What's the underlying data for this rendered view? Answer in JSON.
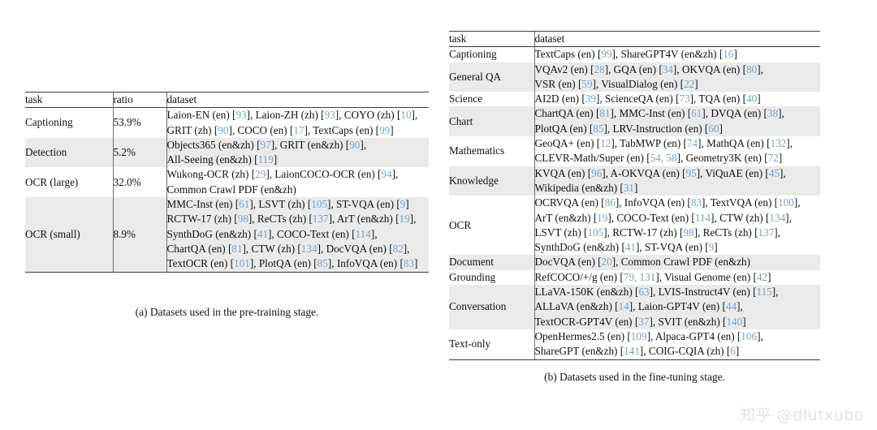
{
  "page": {
    "background": "#ffffff",
    "citation_color": "#7ba2c4",
    "stripe_color": "#eaeaea",
    "rule_color": "#3b3b3b"
  },
  "watermark": {
    "text": "知乎 @dlutxubo"
  },
  "table_a": {
    "caption": "(a) Datasets used in the pre-training stage.",
    "headers": [
      "task",
      "ratio",
      "dataset"
    ],
    "rows": [
      {
        "task": "Captioning",
        "ratio": "53.9%",
        "stripe": false,
        "lines": [
          [
            {
              "t": "Laion-EN (en) ["
            },
            {
              "t": "93",
              "c": true
            },
            {
              "t": "], Laion-ZH (zh) ["
            },
            {
              "t": "93",
              "c": true
            },
            {
              "t": "], COYO (zh) ["
            },
            {
              "t": "10",
              "c": true
            },
            {
              "t": "],"
            }
          ],
          [
            {
              "t": "GRIT (zh) ["
            },
            {
              "t": "90",
              "c": true
            },
            {
              "t": "], COCO (en) ["
            },
            {
              "t": "17",
              "c": true
            },
            {
              "t": "], TextCaps (en) ["
            },
            {
              "t": "99",
              "c": true
            },
            {
              "t": "]"
            }
          ]
        ]
      },
      {
        "task": "Detection",
        "ratio": "5.2%",
        "stripe": true,
        "lines": [
          [
            {
              "t": "Objects365 (en&zh) ["
            },
            {
              "t": "97",
              "c": true
            },
            {
              "t": "], GRIT (en&zh) ["
            },
            {
              "t": "90",
              "c": true
            },
            {
              "t": "],"
            }
          ],
          [
            {
              "t": "All-Seeing (en&zh) ["
            },
            {
              "t": "119",
              "c": true
            },
            {
              "t": "]"
            }
          ]
        ]
      },
      {
        "task": "OCR (large)",
        "ratio": "32.0%",
        "stripe": false,
        "lines": [
          [
            {
              "t": "Wukong-OCR (zh) ["
            },
            {
              "t": "29",
              "c": true
            },
            {
              "t": "], LaionCOCO-OCR (en) ["
            },
            {
              "t": "94",
              "c": true
            },
            {
              "t": "],"
            }
          ],
          [
            {
              "t": "Common Crawl PDF (en&zh)"
            }
          ]
        ]
      },
      {
        "task": "OCR (small)",
        "ratio": "8.9%",
        "stripe": true,
        "lines": [
          [
            {
              "t": "MMC-Inst (en) ["
            },
            {
              "t": "61",
              "c": true
            },
            {
              "t": "], LSVT (zh) ["
            },
            {
              "t": "105",
              "c": true
            },
            {
              "t": "], ST-VQA (en) ["
            },
            {
              "t": "9",
              "c": true
            },
            {
              "t": "]"
            }
          ],
          [
            {
              "t": "RCTW-17 (zh) ["
            },
            {
              "t": "98",
              "c": true
            },
            {
              "t": "], ReCTs (zh) ["
            },
            {
              "t": "137",
              "c": true
            },
            {
              "t": "], ArT (en&zh) ["
            },
            {
              "t": "19",
              "c": true
            },
            {
              "t": "],"
            }
          ],
          [
            {
              "t": "SynthDoG (en&zh) ["
            },
            {
              "t": "41",
              "c": true
            },
            {
              "t": "], COCO-Text (en) ["
            },
            {
              "t": "114",
              "c": true
            },
            {
              "t": "],"
            }
          ],
          [
            {
              "t": "ChartQA (en) ["
            },
            {
              "t": "81",
              "c": true
            },
            {
              "t": "], CTW (zh) ["
            },
            {
              "t": "134",
              "c": true
            },
            {
              "t": "], DocVQA (en) ["
            },
            {
              "t": "82",
              "c": true
            },
            {
              "t": "],"
            }
          ],
          [
            {
              "t": "TextOCR (en) ["
            },
            {
              "t": "101",
              "c": true
            },
            {
              "t": "], PlotQA (en) ["
            },
            {
              "t": "85",
              "c": true
            },
            {
              "t": "], InfoVQA (en) ["
            },
            {
              "t": "83",
              "c": true
            },
            {
              "t": "]"
            }
          ]
        ]
      }
    ]
  },
  "table_b": {
    "caption": "(b) Datasets used in the fine-tuning stage.",
    "headers": [
      "task",
      "dataset"
    ],
    "rows": [
      {
        "task": "Captioning",
        "stripe": false,
        "lines": [
          [
            {
              "t": "TextCaps (en) ["
            },
            {
              "t": "99",
              "c": true
            },
            {
              "t": "], ShareGPT4V (en&zh) ["
            },
            {
              "t": "16",
              "c": true
            },
            {
              "t": "]"
            }
          ]
        ]
      },
      {
        "task": "General QA",
        "stripe": true,
        "lines": [
          [
            {
              "t": "VQAv2 (en) ["
            },
            {
              "t": "28",
              "c": true
            },
            {
              "t": "], GQA (en) ["
            },
            {
              "t": "34",
              "c": true
            },
            {
              "t": "], OKVQA (en) ["
            },
            {
              "t": "80",
              "c": true
            },
            {
              "t": "],"
            }
          ],
          [
            {
              "t": "VSR (en) ["
            },
            {
              "t": "59",
              "c": true
            },
            {
              "t": "], VisualDialog (en) ["
            },
            {
              "t": "22",
              "c": true
            },
            {
              "t": "]"
            }
          ]
        ]
      },
      {
        "task": "Science",
        "stripe": false,
        "lines": [
          [
            {
              "t": "AI2D (en) ["
            },
            {
              "t": "39",
              "c": true
            },
            {
              "t": "], ScienceQA (en) ["
            },
            {
              "t": "73",
              "c": true
            },
            {
              "t": "], TQA (en) ["
            },
            {
              "t": "40",
              "c": true
            },
            {
              "t": "]"
            }
          ]
        ]
      },
      {
        "task": "Chart",
        "stripe": true,
        "lines": [
          [
            {
              "t": "ChartQA (en) ["
            },
            {
              "t": "81",
              "c": true
            },
            {
              "t": "], MMC-Inst (en) ["
            },
            {
              "t": "61",
              "c": true
            },
            {
              "t": "], DVQA (en) ["
            },
            {
              "t": "38",
              "c": true
            },
            {
              "t": "],"
            }
          ],
          [
            {
              "t": "PlotQA (en) ["
            },
            {
              "t": "85",
              "c": true
            },
            {
              "t": "], LRV-Instruction (en) ["
            },
            {
              "t": "60",
              "c": true
            },
            {
              "t": "]"
            }
          ]
        ]
      },
      {
        "task": "Mathematics",
        "stripe": false,
        "lines": [
          [
            {
              "t": "GeoQA+ (en) ["
            },
            {
              "t": "12",
              "c": true
            },
            {
              "t": "], TabMWP (en) ["
            },
            {
              "t": "74",
              "c": true
            },
            {
              "t": "], MathQA (en) ["
            },
            {
              "t": "132",
              "c": true
            },
            {
              "t": "],"
            }
          ],
          [
            {
              "t": "CLEVR-Math/Super (en) ["
            },
            {
              "t": "54, 58",
              "c": true
            },
            {
              "t": "], Geometry3K (en) ["
            },
            {
              "t": "72",
              "c": true
            },
            {
              "t": "]"
            }
          ]
        ]
      },
      {
        "task": "Knowledge",
        "stripe": true,
        "lines": [
          [
            {
              "t": "KVQA (en) ["
            },
            {
              "t": "96",
              "c": true
            },
            {
              "t": "], A-OKVQA (en) ["
            },
            {
              "t": "95",
              "c": true
            },
            {
              "t": "], ViQuAE (en) ["
            },
            {
              "t": "45",
              "c": true
            },
            {
              "t": "],"
            }
          ],
          [
            {
              "t": "Wikipedia (en&zh) ["
            },
            {
              "t": "31",
              "c": true
            },
            {
              "t": "]"
            }
          ]
        ]
      },
      {
        "task": "OCR",
        "stripe": false,
        "lines": [
          [
            {
              "t": "OCRVQA (en) ["
            },
            {
              "t": "86",
              "c": true
            },
            {
              "t": "], InfoVQA (en) ["
            },
            {
              "t": "83",
              "c": true
            },
            {
              "t": "], TextVQA (en) ["
            },
            {
              "t": "100",
              "c": true
            },
            {
              "t": "],"
            }
          ],
          [
            {
              "t": "ArT (en&zh) ["
            },
            {
              "t": "19",
              "c": true
            },
            {
              "t": "], COCO-Text (en) ["
            },
            {
              "t": "114",
              "c": true
            },
            {
              "t": "], CTW (zh) ["
            },
            {
              "t": "134",
              "c": true
            },
            {
              "t": "],"
            }
          ],
          [
            {
              "t": "LSVT (zh) ["
            },
            {
              "t": "105",
              "c": true
            },
            {
              "t": "], RCTW-17 (zh) ["
            },
            {
              "t": "98",
              "c": true
            },
            {
              "t": "], ReCTs (zh) ["
            },
            {
              "t": "137",
              "c": true
            },
            {
              "t": "],"
            }
          ],
          [
            {
              "t": "SynthDoG (en&zh) ["
            },
            {
              "t": "41",
              "c": true
            },
            {
              "t": "], ST-VQA (en) ["
            },
            {
              "t": "9",
              "c": true
            },
            {
              "t": "]"
            }
          ]
        ]
      },
      {
        "task": "Document",
        "stripe": true,
        "lines": [
          [
            {
              "t": "DocVQA (en) ["
            },
            {
              "t": "20",
              "c": true
            },
            {
              "t": "], Common Crawl PDF (en&zh)"
            }
          ]
        ]
      },
      {
        "task": "Grounding",
        "stripe": false,
        "lines": [
          [
            {
              "t": "RefCOCO/+/g (en) ["
            },
            {
              "t": "79, 131",
              "c": true
            },
            {
              "t": "], Visual Genome (en) ["
            },
            {
              "t": "42",
              "c": true
            },
            {
              "t": "]"
            }
          ]
        ]
      },
      {
        "task": "Conversation",
        "stripe": true,
        "lines": [
          [
            {
              "t": "LLaVA-150K (en&zh) ["
            },
            {
              "t": "63",
              "c": true
            },
            {
              "t": "], LVIS-Instruct4V (en) ["
            },
            {
              "t": "115",
              "c": true
            },
            {
              "t": "],"
            }
          ],
          [
            {
              "t": "ALLaVA (en&zh) ["
            },
            {
              "t": "14",
              "c": true
            },
            {
              "t": "], Laion-GPT4V (en) ["
            },
            {
              "t": "44",
              "c": true
            },
            {
              "t": "],"
            }
          ],
          [
            {
              "t": "TextOCR-GPT4V (en) ["
            },
            {
              "t": "37",
              "c": true
            },
            {
              "t": "], SVIT (en&zh) ["
            },
            {
              "t": "140",
              "c": true
            },
            {
              "t": "]"
            }
          ]
        ]
      },
      {
        "task": "Text-only",
        "stripe": false,
        "lines": [
          [
            {
              "t": "OpenHermes2.5 (en) ["
            },
            {
              "t": "109",
              "c": true
            },
            {
              "t": "], Alpaca-GPT4 (en) ["
            },
            {
              "t": "106",
              "c": true
            },
            {
              "t": "],"
            }
          ],
          [
            {
              "t": "ShareGPT (en&zh) ["
            },
            {
              "t": "141",
              "c": true
            },
            {
              "t": "], COIG-CQIA (zh) ["
            },
            {
              "t": "6",
              "c": true
            },
            {
              "t": "]"
            }
          ]
        ]
      }
    ]
  }
}
